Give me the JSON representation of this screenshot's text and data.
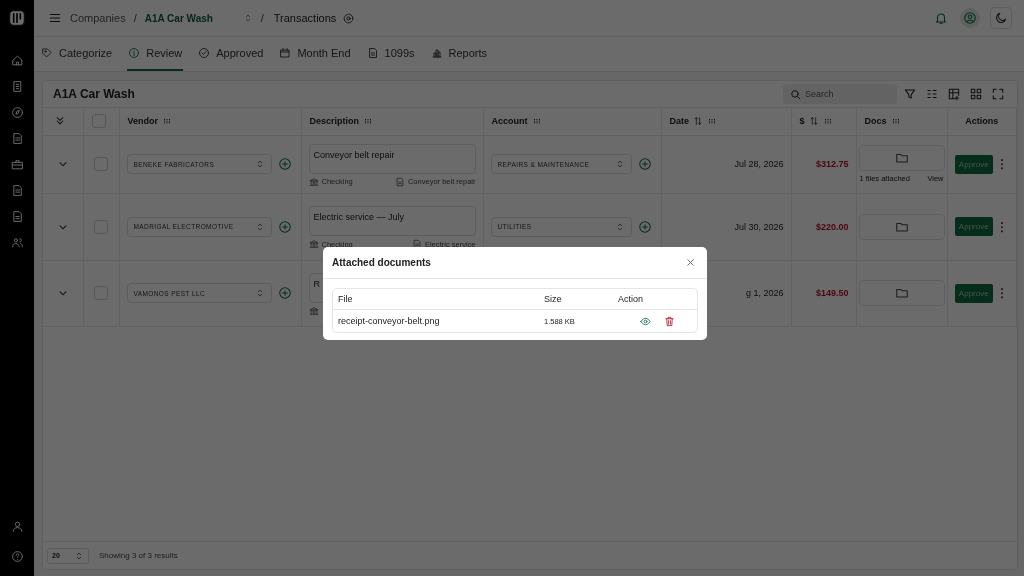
{
  "breadcrumb": {
    "items": [
      {
        "label": "Companies",
        "kind": "link"
      },
      {
        "label": "/",
        "kind": "separator"
      },
      {
        "label": "A1A Car Wash",
        "kind": "select"
      },
      {
        "label": "/",
        "kind": "separator"
      },
      {
        "label": "Transactions",
        "kind": "current"
      }
    ]
  },
  "tabs": [
    {
      "label": "Categorize",
      "selected": false
    },
    {
      "label": "Review",
      "selected": true
    },
    {
      "label": "Approved",
      "selected": false
    },
    {
      "label": "Month End",
      "selected": false
    },
    {
      "label": "1099s",
      "selected": false
    },
    {
      "label": "Reports",
      "selected": false
    }
  ],
  "card": {
    "title": "A1A Car Wash",
    "search": {
      "placeholder": "Search"
    },
    "all_selected": false,
    "columns": [
      {
        "label": "Vendor",
        "kind": "plain"
      },
      {
        "label": "Description",
        "kind": "plain"
      },
      {
        "label": "Account",
        "kind": "plain"
      },
      {
        "label": "Date",
        "kind": "sortable"
      },
      {
        "label": "$",
        "kind": "sortable"
      },
      {
        "label": "Docs",
        "kind": "plain"
      },
      {
        "label": "Actions",
        "kind": "plain"
      }
    ],
    "rows": [
      {
        "selected": false,
        "vendor": "BENEKE FABRICATORS",
        "description": "Conveyor belt repair",
        "bank": "Checking",
        "memo": "Conveyor belt repair",
        "account": "REPAIRS & MAINTENANCE",
        "date": "Jul 28, 2026",
        "amount": "$312.75",
        "files": "1 files attached",
        "view": "View",
        "action": "Approve"
      },
      {
        "selected": false,
        "vendor": "MADRIGAL ELECTROMOTIVE",
        "description": "Electric service — July",
        "bank": "Checking",
        "memo": "Electric service",
        "account": "UTILITIES",
        "date": "Jul 30, 2026",
        "amount": "$220.00",
        "action": "Approve"
      },
      {
        "selected": false,
        "vendor": "VAMONOS PEST LLC",
        "description": "R",
        "date": "g 1, 2026",
        "amount": "$149.50",
        "action": "Approve"
      }
    ],
    "page_size": "20",
    "results": "Showing 3 of 3 results"
  },
  "modal": {
    "title": "Attached documents",
    "columns": [
      "File",
      "Size",
      "Action"
    ],
    "files": [
      {
        "name": "receipt-conveyor-belt.png",
        "size": "1.588 KB"
      }
    ]
  }
}
